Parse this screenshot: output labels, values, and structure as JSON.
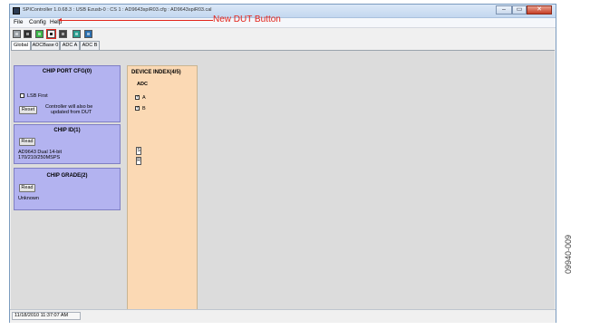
{
  "window": {
    "title": "SPIController 1.0.68.3 : USB Ezusb-0 : CS 1 : AD9643spiR03.cfg : AD9643spiR03.cal",
    "controls": {
      "minimize": "–",
      "maximize": "▭",
      "close": "✕"
    }
  },
  "menu": {
    "items": [
      "File",
      "Config",
      "Help"
    ]
  },
  "annotation": {
    "label": "New DUT Button"
  },
  "toolbar": {
    "buttons": [
      {
        "icon": "cut-icon",
        "color": "#9aa0a6"
      },
      {
        "icon": "save-icon",
        "color": "#2f2f2f"
      },
      {
        "icon": "open-config-icon",
        "color": "#3cb54a"
      },
      {
        "icon": "new-dut-icon",
        "color": "#ffffff",
        "selected": true
      },
      {
        "icon": "reload-icon",
        "color": "#404040"
      },
      {
        "icon": "chip-info-icon",
        "color": "#2a9d8f"
      },
      {
        "icon": "settings-icon",
        "color": "#2a6fb0"
      }
    ]
  },
  "tabs": [
    "Global",
    "ADCBase 0",
    "ADC A",
    "ADC B"
  ],
  "panels": {
    "chip_port_cfg": {
      "title": "CHIP PORT CFG(0)",
      "checkbox_label": "LSB First",
      "reset_button": "Reset",
      "note": [
        "Controller will also be",
        "updated from DUT"
      ]
    },
    "chip_id": {
      "title": "CHIP ID(1)",
      "read_button": "Read",
      "value": [
        "AD9643 Dual 14-bit",
        "170/210/250MSPS"
      ]
    },
    "chip_grade": {
      "title": "CHIP GRADE(2)",
      "read_button": "Read",
      "value": "Unknown"
    },
    "device_index": {
      "title": "DEVICE INDEX(4/5)",
      "subtitle": "ADC",
      "channels": [
        {
          "label": "A",
          "checked": true
        },
        {
          "label": "B",
          "checked": true
        }
      ],
      "side_buttons": [
        "S",
        "R"
      ]
    }
  },
  "status": {
    "timestamp": "11/18/2010 11:37:07 AM"
  },
  "figure_id": "09940-009"
}
